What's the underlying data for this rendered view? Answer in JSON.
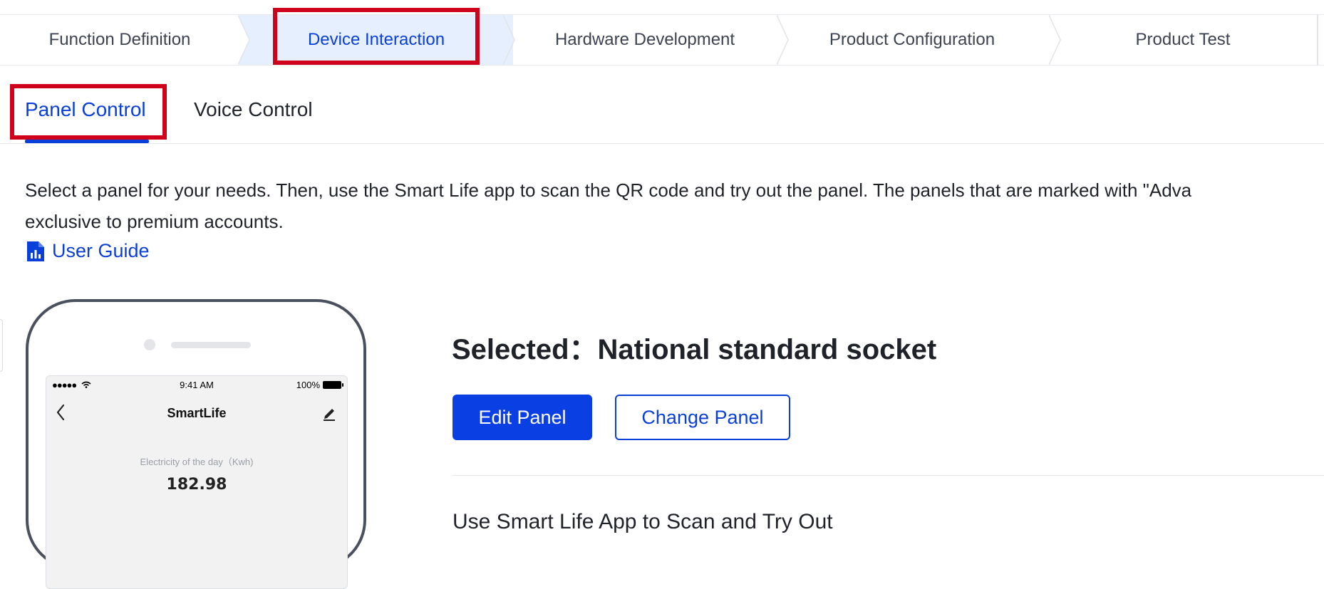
{
  "steps": [
    {
      "label": "Function Definition",
      "active": false
    },
    {
      "label": "Device Interaction",
      "active": true
    },
    {
      "label": "Hardware Development",
      "active": false
    },
    {
      "label": "Product Configuration",
      "active": false
    },
    {
      "label": "Product Test",
      "active": false
    }
  ],
  "tabs": [
    {
      "label": "Panel Control",
      "active": true
    },
    {
      "label": "Voice Control",
      "active": false
    }
  ],
  "description": {
    "line1": "Select a panel for your needs. Then, use the Smart Life app to scan the QR code and try out the panel. The panels that are marked with \"Adva",
    "line2": "exclusive to premium accounts."
  },
  "user_guide": {
    "label": "User Guide",
    "icon": "document-chart-icon"
  },
  "phone_preview": {
    "status_signal": "●●●●●",
    "status_time": "9:41 AM",
    "status_battery": "100%",
    "app_title": "SmartLife",
    "electricity_label": "Electricity of the day（Kwh)",
    "electricity_value": "182.98"
  },
  "panel": {
    "selected_label": "Selected：National standard socket",
    "edit_button": "Edit Panel",
    "change_button": "Change Panel",
    "scan_heading": "Use Smart Life App to Scan and Try Out"
  },
  "colors": {
    "accent": "#0a3fd9",
    "active_step_bg": "#e6effd",
    "highlight": "#d0021b"
  }
}
